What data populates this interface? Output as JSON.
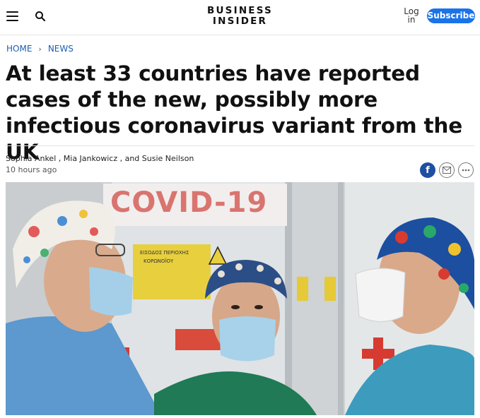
{
  "header": {
    "logo_line1": "BUSINESS",
    "logo_line2": "INSIDER",
    "login_line1": "Log",
    "login_line2": "in",
    "subscribe_label": "Subscribe",
    "menu_icon": "hamburger-menu-icon",
    "search_icon": "search-icon",
    "subscribe_color": "#1a73e8"
  },
  "breadcrumb": {
    "items": [
      "HOME",
      "NEWS"
    ],
    "separator": "›"
  },
  "article": {
    "headline": "At least 33 countries have reported cases of the new, possibly more infectious coronavirus variant from the UK",
    "authors": [
      "Sophia Ankel",
      "Mia Jankowicz",
      "Susie Neilson"
    ],
    "author_sep1": " , ",
    "author_sep2": " , and ",
    "timestamp": "10 hours ago"
  },
  "share": {
    "facebook_label": "f",
    "icons": [
      "facebook-icon",
      "email-icon",
      "more-icon"
    ]
  },
  "hero_image": {
    "sign_text": "COVID-19",
    "warning_line1": "ΕΙΣΟΔΟΣ ΠΕΡΙΟΧΗΣ",
    "warning_line2": "ΚΟΡΩΝΟΪΟΥ"
  }
}
